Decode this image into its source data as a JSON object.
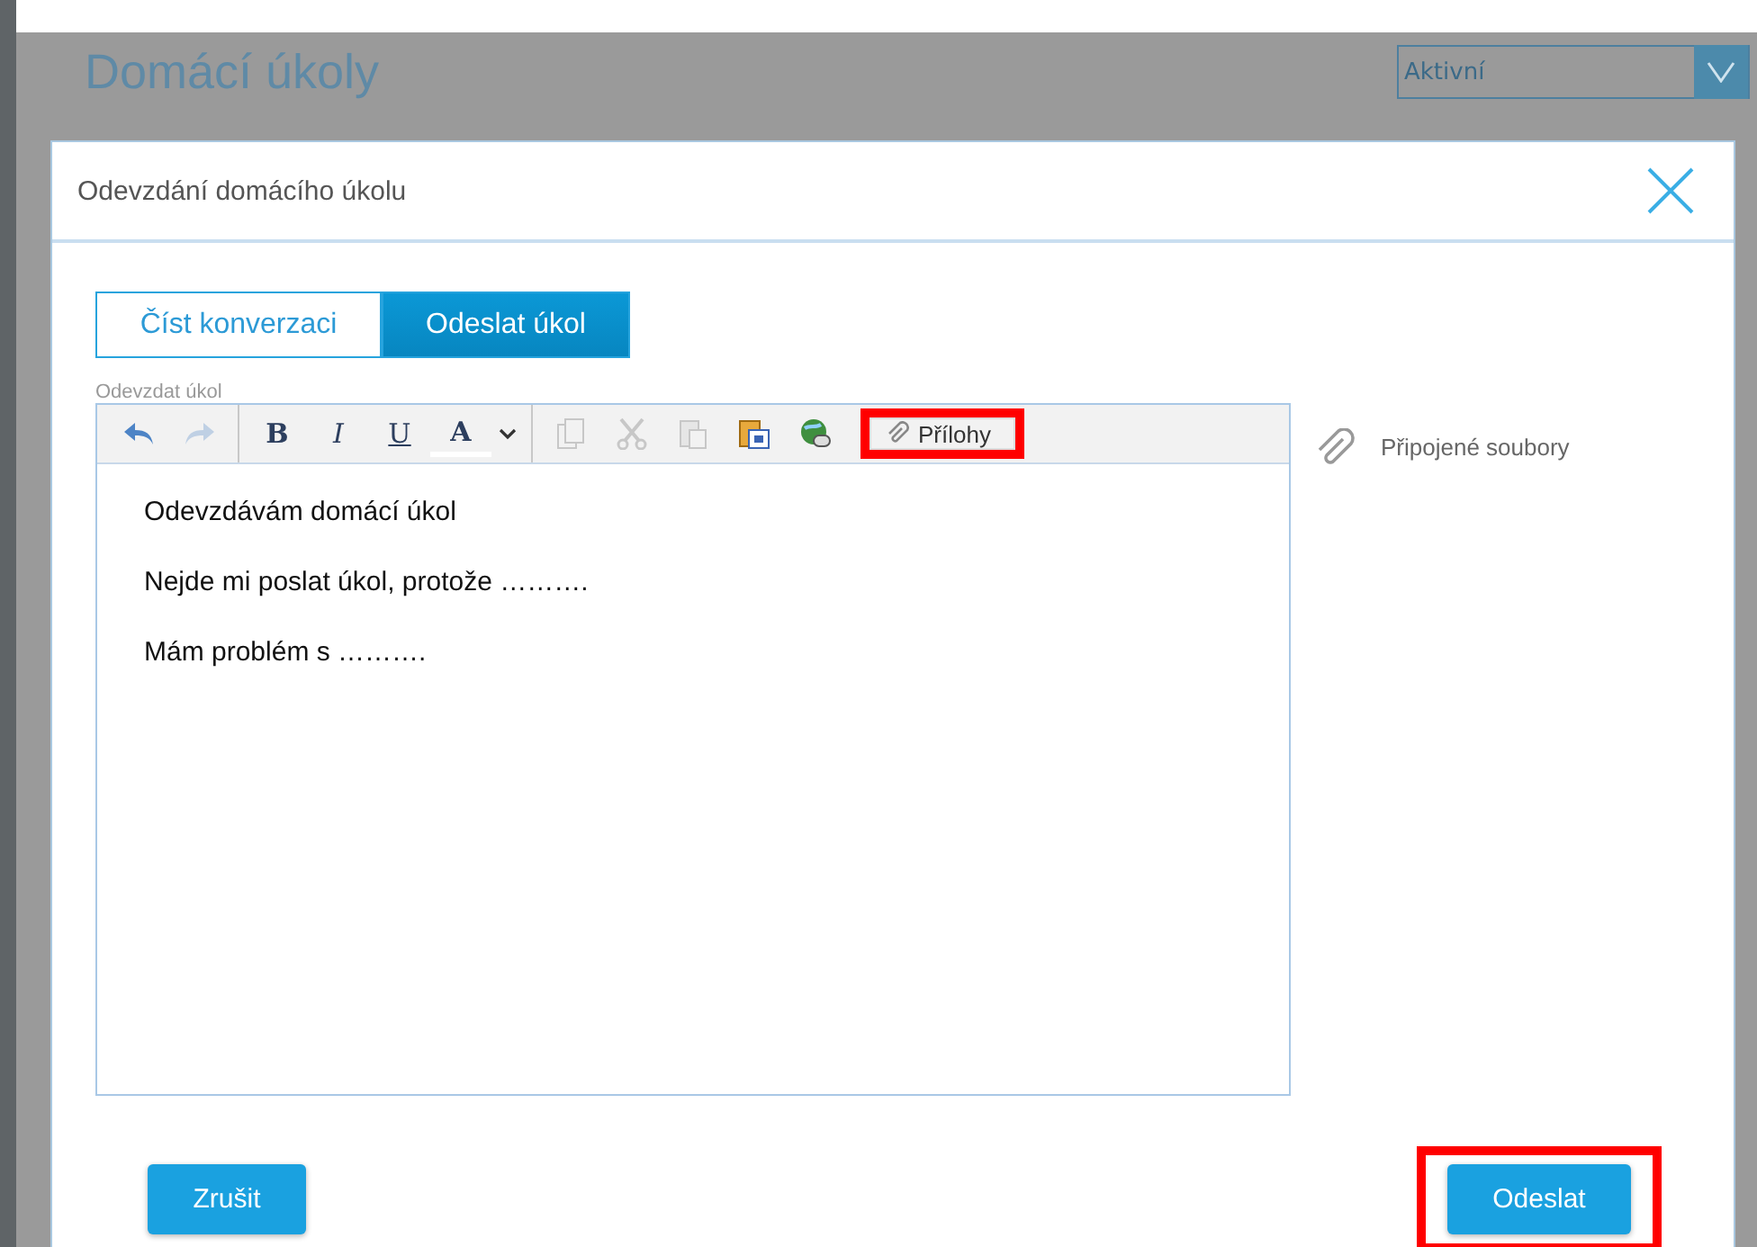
{
  "page": {
    "title": "Domácí úkoly",
    "filter": {
      "value": "Aktivní"
    }
  },
  "dialog": {
    "title": "Odevzdání domácího úkolu",
    "tabs": [
      {
        "label": "Číst konverzaci",
        "selected": false
      },
      {
        "label": "Odeslat úkol",
        "selected": true
      }
    ],
    "editor_label": "Odevzdat úkol",
    "toolbar": [
      {
        "kind": "icon",
        "disabled": false
      },
      {
        "kind": "icon",
        "disabled": true
      },
      {
        "kind": "separator"
      },
      {
        "kind": "format",
        "label": "B"
      },
      {
        "kind": "format",
        "label": "I"
      },
      {
        "kind": "format",
        "label": "U"
      },
      {
        "kind": "format",
        "label": "A"
      },
      {
        "kind": "icon",
        "disabled": false
      },
      {
        "kind": "separator"
      },
      {
        "kind": "icon",
        "disabled": true
      },
      {
        "kind": "icon",
        "disabled": true
      },
      {
        "kind": "icon",
        "disabled": true
      },
      {
        "kind": "icon",
        "disabled": false
      },
      {
        "kind": "icon",
        "disabled": false
      },
      {
        "kind": "button",
        "label": "Přílohy",
        "highlighted": true
      }
    ],
    "body": [
      "Odevzdávám domácí úkol",
      "Nejde mi poslat úkol, protože ……….",
      "Mám problém s ………."
    ],
    "attachments_label": "Připojené soubory",
    "buttons": [
      {
        "label": "Zrušit",
        "highlighted": false
      },
      {
        "label": "Odeslat",
        "highlighted": true
      }
    ]
  }
}
